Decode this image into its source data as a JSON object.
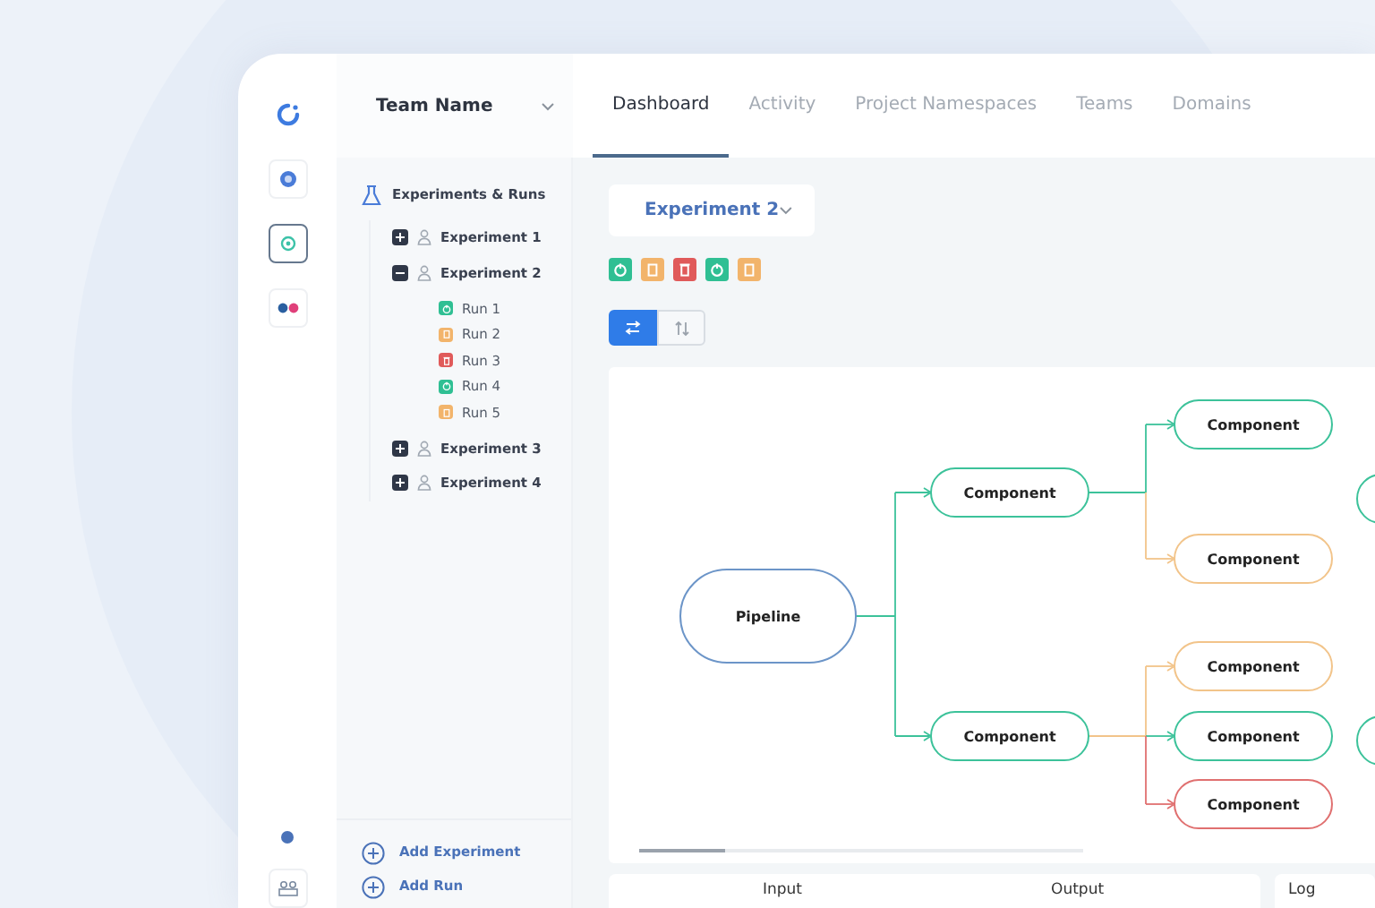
{
  "rail": {
    "items": [
      {
        "selected": false
      },
      {
        "selected": true
      },
      {
        "selected": false
      }
    ]
  },
  "team_selector": {
    "label": "Team Name"
  },
  "tabs": [
    {
      "label": "Dashboard",
      "selected": true
    },
    {
      "label": "Activity",
      "selected": false
    },
    {
      "label": "Project Namespaces",
      "selected": false
    },
    {
      "label": "Teams",
      "selected": false
    },
    {
      "label": "Domains",
      "selected": false
    }
  ],
  "sidebar": {
    "title": "Experiments & Runs",
    "experiments": [
      {
        "label": "Experiment 1",
        "expanded": false
      },
      {
        "label": "Experiment 2",
        "expanded": true,
        "children": [
          {
            "label": "Run 1",
            "kind": "power",
            "color": "#2fbf93"
          },
          {
            "label": "Run 2",
            "kind": "clipboard",
            "color": "#f2b46b"
          },
          {
            "label": "Run 3",
            "kind": "trash",
            "color": "#e05a5a"
          },
          {
            "label": "Run 4",
            "kind": "power",
            "color": "#2fbf93"
          },
          {
            "label": "Run 5",
            "kind": "clipboard",
            "color": "#f2b46b"
          }
        ]
      },
      {
        "label": "Experiment 3",
        "expanded": false
      },
      {
        "label": "Experiment 4",
        "expanded": false
      }
    ],
    "actions": [
      "Add Experiment",
      "Add Run"
    ]
  },
  "experiment_selector": {
    "label": "Experiment 2"
  },
  "run_status": [
    {
      "kind": "power",
      "color": "#2fbf93"
    },
    {
      "kind": "clipboard",
      "color": "#f2b46b"
    },
    {
      "kind": "trash",
      "color": "#e05a5a"
    },
    {
      "kind": "power",
      "color": "#2fbf93"
    },
    {
      "kind": "clipboard",
      "color": "#f2b46b"
    }
  ],
  "view_toggle": [
    {
      "selected": true
    },
    {
      "selected": false
    }
  ],
  "pipeline": {
    "label": "Pipeline",
    "components": [
      {
        "label": "Component",
        "color": "#3cc29a",
        "children": [
          {
            "label": "Component",
            "color": "#3cc29a"
          },
          {
            "label": "Component",
            "color": "#f2c48a"
          }
        ]
      },
      {
        "label": "Component",
        "color": "#3cc29a",
        "children": [
          {
            "label": "Component",
            "color": "#f2c48a"
          },
          {
            "label": "Component",
            "color": "#3cc29a"
          },
          {
            "label": "Component",
            "color": "#e07070"
          }
        ]
      }
    ]
  },
  "panels": [
    "Input",
    "Output",
    "Log"
  ]
}
